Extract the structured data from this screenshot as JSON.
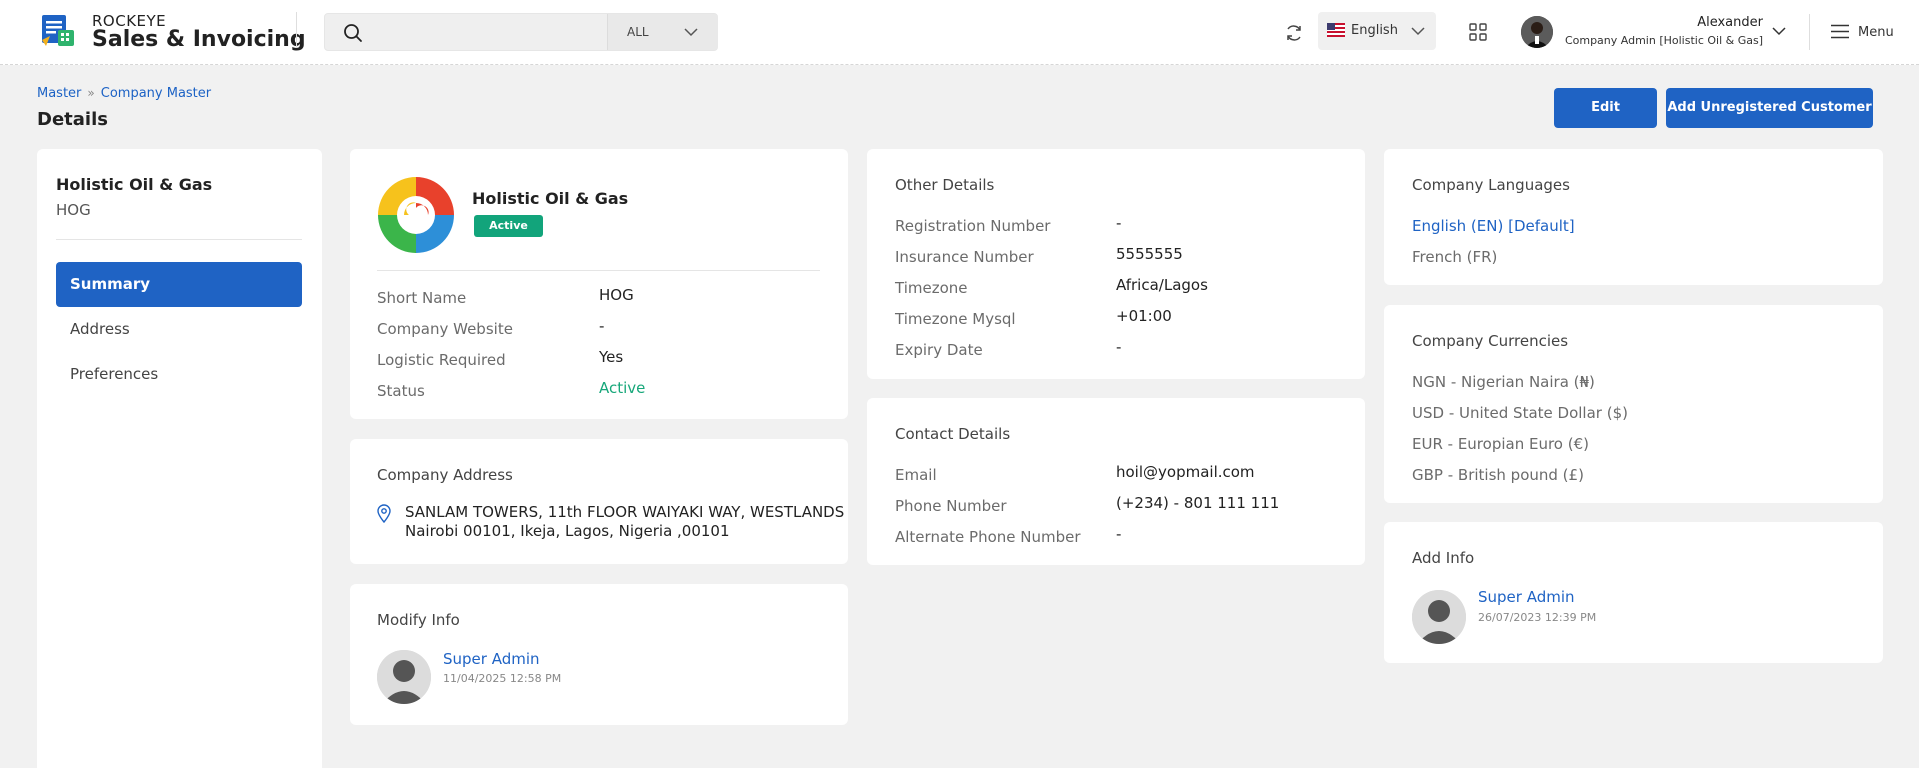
{
  "header": {
    "brand_top": "ROCKEYE",
    "brand_main": "Sales & Invoicing",
    "search": {
      "placeholder": "",
      "filter": "ALL"
    },
    "language": "English",
    "user": {
      "name": "Alexander",
      "role": "Company Admin [Holistic Oil & Gas]"
    },
    "menu_label": "Menu"
  },
  "breadcrumb": [
    "Master",
    "Company Master"
  ],
  "page_title": "Details",
  "actions": {
    "edit": "Edit",
    "add_unregistered": "Add Unregistered Customer"
  },
  "sidebar": {
    "company_name": "Holistic Oil & Gas",
    "short_name": "HOG",
    "items": [
      {
        "label": "Summary",
        "active": true
      },
      {
        "label": "Address",
        "active": false
      },
      {
        "label": "Preferences",
        "active": false
      }
    ]
  },
  "company_card": {
    "name": "Holistic Oil & Gas",
    "status_badge": "Active",
    "rows": [
      {
        "label": "Short Name",
        "value": "HOG"
      },
      {
        "label": "Company Website",
        "value": "-"
      },
      {
        "label": "Logistic Required",
        "value": "Yes"
      },
      {
        "label": "Status",
        "value": "Active"
      }
    ]
  },
  "address_card": {
    "title": "Company Address",
    "line1": "SANLAM TOWERS, 11th FLOOR WAIYAKI WAY, WESTLANDS",
    "line2": "Nairobi 00101, Ikeja, Lagos, Nigeria ,00101"
  },
  "modify_info": {
    "title": "Modify Info",
    "user": "Super Admin",
    "date": "11/04/2025 12:58 PM"
  },
  "other_details": {
    "title": "Other Details",
    "rows": [
      {
        "label": "Registration Number",
        "value": "-"
      },
      {
        "label": "Insurance Number",
        "value": "5555555"
      },
      {
        "label": "Timezone",
        "value": "Africa/Lagos"
      },
      {
        "label": "Timezone Mysql",
        "value": "+01:00"
      },
      {
        "label": "Expiry Date",
        "value": "-"
      }
    ]
  },
  "contact_details": {
    "title": "Contact Details",
    "rows": [
      {
        "label": "Email",
        "value": "hoil@yopmail.com"
      },
      {
        "label": "Phone Number",
        "value": "(+234) - 801 111 111"
      },
      {
        "label": "Alternate Phone Number",
        "value": "-"
      }
    ]
  },
  "languages": {
    "title": "Company Languages",
    "items": [
      "English (EN) [Default]",
      "French (FR)"
    ]
  },
  "currencies": {
    "title": "Company Currencies",
    "items": [
      "NGN - Nigerian Naira (₦)",
      "USD - United State Dollar ($)",
      "EUR - Europian Euro (€)",
      "GBP - British pound (£)"
    ]
  },
  "add_info": {
    "title": "Add Info",
    "user": "Super Admin",
    "date": "26/07/2023 12:39 PM"
  },
  "colors": {
    "primary": "#1f63c4",
    "success": "#12a47b",
    "background": "#f1f1f1"
  }
}
